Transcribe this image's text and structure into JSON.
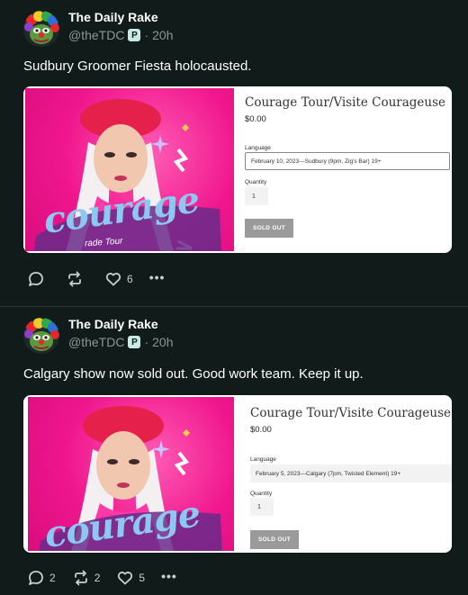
{
  "posts": [
    {
      "author": {
        "name": "The Daily Rake",
        "handle": "@theTDC",
        "badge": "P",
        "time": "20h"
      },
      "text": "Sudbury Groomer Fiesta holocausted.",
      "card": {
        "image_text": "courage",
        "image_subtext": "rade Tour",
        "shop_title": "Courage Tour/Visite Courageuse",
        "price": "$0.00",
        "language_label": "Language",
        "language_value": "February 10, 2023—Sudbury (9pm, Zig's Bar) 19+",
        "quantity_label": "Quantity",
        "quantity_value": "1",
        "button_label": "SOLD OUT"
      },
      "actions": {
        "replies": "",
        "reposts": "",
        "likes": "6"
      }
    },
    {
      "author": {
        "name": "The Daily Rake",
        "handle": "@theTDC",
        "badge": "P",
        "time": "20h"
      },
      "text": "Calgary show now sold out. Good work team. Keep it up.",
      "card": {
        "image_text": "courage",
        "image_subtext": "",
        "shop_title": "Courage Tour/Visite Courageuse",
        "price": "$0.00",
        "language_label": "Language",
        "language_value": "February 5, 2023—Calgary (7pm, Twisted Element)  19+",
        "quantity_label": "Quantity",
        "quantity_value": "1",
        "button_label": "SOLD OUT"
      },
      "actions": {
        "replies": "2",
        "reposts": "2",
        "likes": "5"
      }
    }
  ],
  "meta_separator": "·",
  "more_label": "•••",
  "colors": {
    "background": "#101b1a",
    "card_pink": "#f0168d",
    "muted": "#8a9896"
  }
}
